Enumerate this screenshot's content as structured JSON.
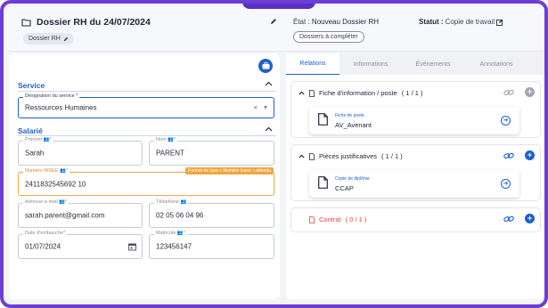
{
  "header": {
    "title": "Dossier RH du 24/07/2024",
    "tag": "Dossier RH",
    "etat_label": "État :",
    "etat_value": "Nouveau Dossier RH",
    "statut_label": "Statut :",
    "statut_value": "Copie de travail",
    "pending_button": "Dossiers à compléter"
  },
  "left": {
    "service_title": "Service",
    "designation_label": "Désignation du service *",
    "designation_value": "Ressources Humaines",
    "salarie_title": "Salarié",
    "fields": {
      "prenom_label": "Prénom 👥*",
      "prenom_value": "Sarah",
      "nom_label": "Nom 👥*",
      "nom_value": "PARENT",
      "insee_label": "Numéro INSEE 👥*",
      "insee_value": "2411832545692 10",
      "insee_warning": "Format de type « Numéro Insee » attendu",
      "email_label": "Adresse e-mail 👥*",
      "email_value": "sarah.parent@gmail.com",
      "tel_label": "Téléphone 👥",
      "tel_value": "02 05 06 04 96",
      "date_label": "Date d'embauche*",
      "date_value": "01/07/2024",
      "matricule_label": "Matricule 👥*",
      "matricule_value": "123456147"
    }
  },
  "right": {
    "tabs": [
      "Relations",
      "Informations",
      "Événements",
      "Annotations"
    ],
    "groups": [
      {
        "title": "Fiche d'information / poste",
        "count": "( 1 / 1 )",
        "card_sub": "Fiche de poste",
        "card_main": "AV_Avenant"
      },
      {
        "title": "Pièces justificatives",
        "count": "( 1 / 1 )",
        "card_sub": "Copie de diplôme",
        "card_main": "CCAP"
      },
      {
        "title": "Contrat",
        "count": "( 0 / 1 )"
      }
    ]
  },
  "colors": {
    "accent": "#1f5fcf",
    "frame": "#6b3fd6",
    "warning": "#f0a640",
    "error": "#e0473d"
  },
  "icons": [
    "folder-icon",
    "pencil-icon",
    "edit-square-icon",
    "chevron-up-icon",
    "document-icon",
    "link-icon",
    "plus-circle-icon",
    "arrow-right-circle-icon",
    "calendar-icon",
    "clear-icon",
    "dropdown-caret-icon",
    "briefcase-icon"
  ]
}
